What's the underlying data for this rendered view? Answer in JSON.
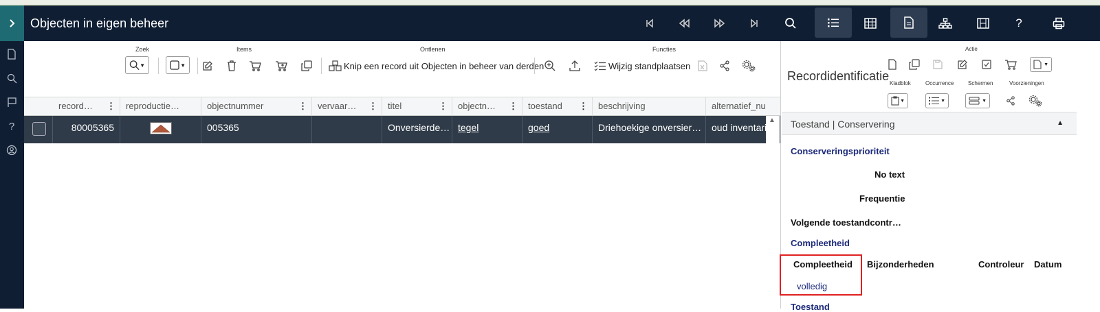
{
  "app": {
    "title": "Objecten in eigen beheer"
  },
  "nav_icons": [
    "first-record-icon",
    "previous-record-icon",
    "next-record-icon",
    "last-record-icon",
    "search-icon",
    "list-view-icon",
    "grid-view-icon",
    "record-view-icon",
    "hierarchy-icon",
    "filmstrip-icon",
    "help-icon",
    "print-icon"
  ],
  "sidebar_icons": [
    "document-icon",
    "search-icon",
    "flag-icon",
    "help-icon",
    "user-icon"
  ],
  "toolbar": {
    "groups": {
      "zoek": "Zoek",
      "items": "Items",
      "ontlenen": "Ontlenen",
      "functies": "Functies"
    },
    "knip_label": "Knip een record uit Objecten in beheer van derden",
    "wijzig_label": "Wijzig standplaatsen"
  },
  "grid": {
    "columns": [
      {
        "label": "record…"
      },
      {
        "label": "reproductie…"
      },
      {
        "label": "objectnummer"
      },
      {
        "label": "vervaar…"
      },
      {
        "label": "titel"
      },
      {
        "label": "objectn…"
      },
      {
        "label": "toestand"
      },
      {
        "label": "beschrijving"
      },
      {
        "label": "alternatief_nu"
      }
    ],
    "row": {
      "record": "80005365",
      "objectnummer": "005365",
      "vervaardiger": "",
      "titel": "Onversierde…",
      "objectnaam": "tegel",
      "toestand": "goed",
      "beschrijving": "Driehoekige onversier…",
      "alternatief": "oud inventaris"
    }
  },
  "panel": {
    "title": "Recordidentificatie",
    "labels": {
      "actie": "Actie",
      "kladblok": "Kladblok",
      "occurrence": "Occurrence",
      "schermen": "Schermen",
      "voorzieningen": "Voorzieningen"
    },
    "section": "Toestand | Conservering",
    "fields": {
      "conserveringsprioriteit": "Conserveringsprioriteit",
      "no_text": "No text",
      "frequentie": "Frequentie",
      "volgende": "Volgende toestandcontr…",
      "compleetheid_heading": "Compleetheid",
      "compleetheid_col": "Compleetheid",
      "bijzonderheden_col": "Bijzonderheden",
      "controleur_col": "Controleur",
      "datum_col": "Datum",
      "compleetheid_value": "volledig",
      "toestand_heading": "Toestand"
    }
  },
  "colors": {
    "topbar": "#0f1e33",
    "accent": "#1f6b73",
    "selected_row": "#2f3b48",
    "field_blue": "#1c2a7a",
    "highlight": "#e02020"
  }
}
